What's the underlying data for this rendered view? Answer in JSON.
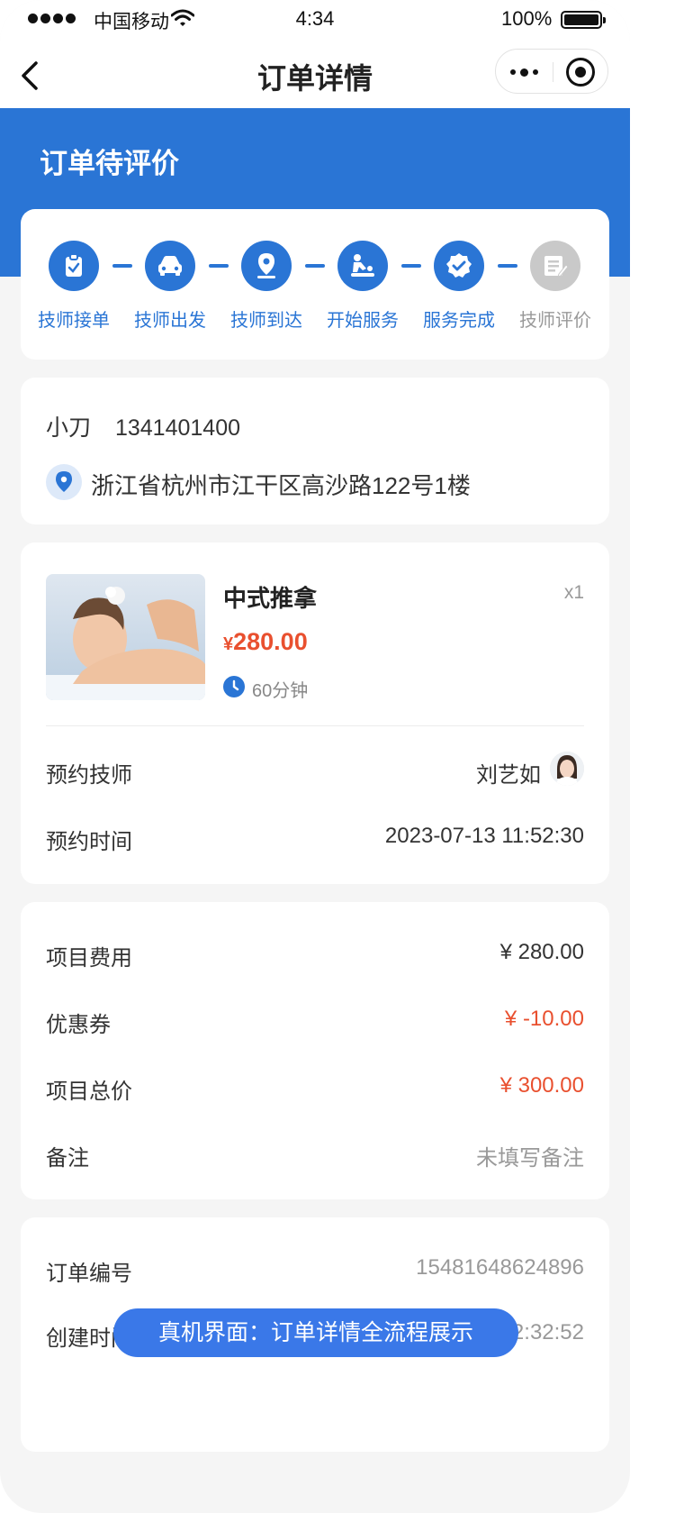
{
  "status_bar": {
    "carrier": "中国移动",
    "time": "4:34",
    "battery": "100%"
  },
  "nav": {
    "title": "订单详情"
  },
  "order_status": "订单待评价",
  "steps": [
    {
      "label": "技师接单",
      "icon": "clipboard-check-icon",
      "active": true
    },
    {
      "label": "技师出发",
      "icon": "car-icon",
      "active": true
    },
    {
      "label": "技师到达",
      "icon": "location-pin-icon",
      "active": true
    },
    {
      "label": "开始服务",
      "icon": "massage-icon",
      "active": true
    },
    {
      "label": "服务完成",
      "icon": "verified-badge-icon",
      "active": true
    },
    {
      "label": "技师评价",
      "icon": "review-form-icon",
      "active": false
    }
  ],
  "contact": {
    "name": "小刀",
    "phone": "1341401400",
    "address": "浙江省杭州市江干区高沙路122号1楼"
  },
  "service": {
    "name": "中式推拿",
    "qty": "x1",
    "currency": "¥",
    "price": "280.00",
    "duration": "60分钟",
    "technician_label": "预约技师",
    "technician_name": "刘艺如",
    "time_label": "预约时间",
    "time_value": "2023-07-13 11:52:30"
  },
  "fees": {
    "item_fee_label": "项目费用",
    "item_fee_value": "¥ 280.00",
    "coupon_label": "优惠券",
    "coupon_value": "¥ -10.00",
    "total_label": "项目总价",
    "total_value": "¥ 300.00",
    "remark_label": "备注",
    "remark_value": "未填写备注"
  },
  "order_info": {
    "order_no_label": "订单编号",
    "order_no_value": "15481648624896",
    "created_label": "创建时间",
    "created_value_visible": "12:32:52"
  },
  "banner": "真机界面：订单详情全流程展示",
  "colors": {
    "primary": "#2a75d5",
    "price_red": "#e9502f",
    "inactive": "#c9c9c9",
    "background": "#f5f5f5"
  }
}
